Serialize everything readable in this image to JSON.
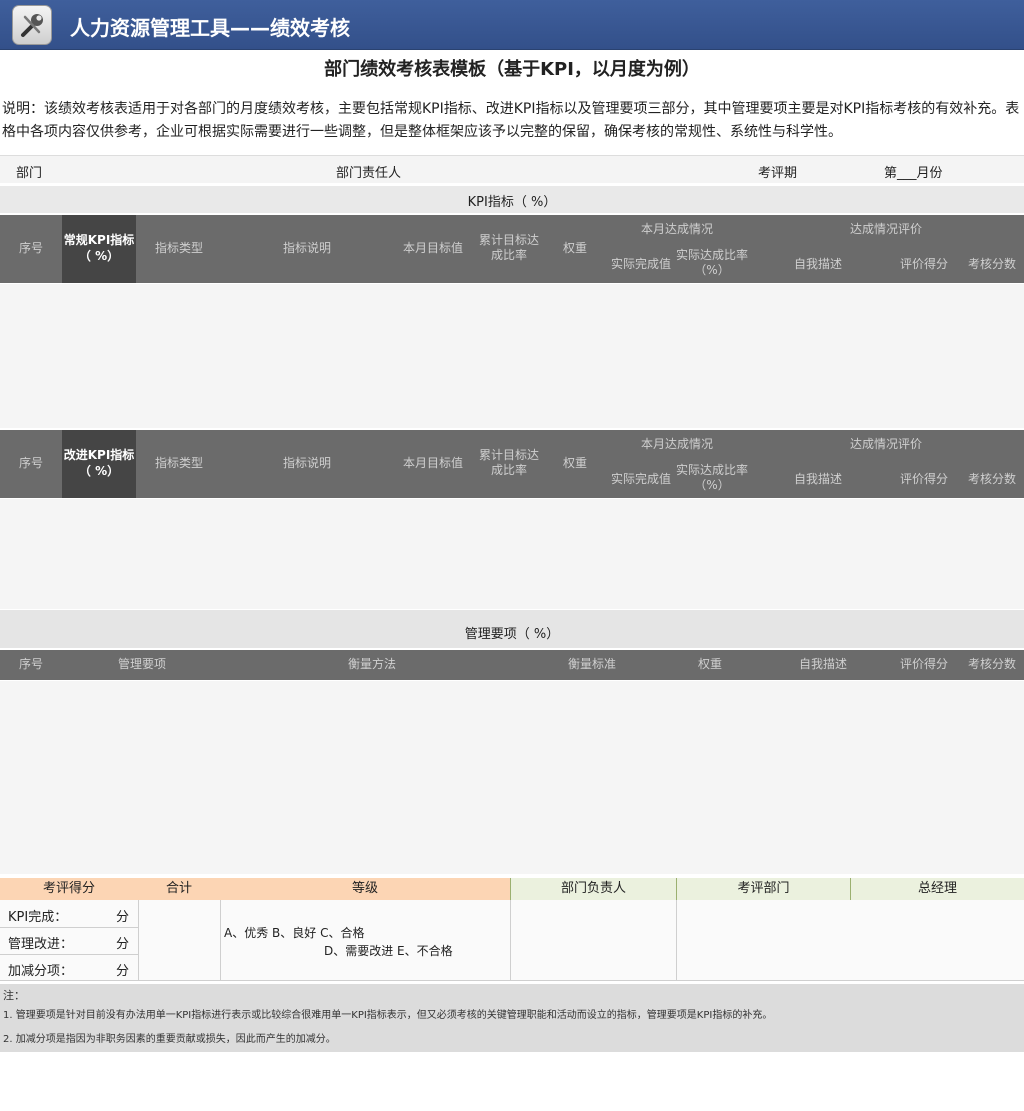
{
  "app": {
    "title": "人力资源管理工具——绩效考核",
    "icon": "tools-icon"
  },
  "document": {
    "title": "部门绩效考核表模板（基于KPI，以月度为例）",
    "description": "说明：该绩效考核表适用于对各部门的月度绩效考核，主要包括常规KPI指标、改进KPI指标以及管理要项三部分，其中管理要项主要是对KPI指标考核的有效补充。表格中各项内容仅供参考，企业可根据实际需要进行一些调整，但是整体框架应该予以完整的保留，确保考核的常规性、系统性与科学性。"
  },
  "info_row": {
    "dept_label": "部门",
    "manager_label": "部门责任人",
    "period_label": "考评期",
    "month_label": "第___月份"
  },
  "kpi_section": {
    "label": "KPI指标（      %）"
  },
  "table1": {
    "seq": "序号",
    "category": "常规KPI指标（  %）",
    "indicator_type": "指标类型",
    "indicator_def": "指标说明",
    "month_target": "本月目标值",
    "cumulative": "累计目标达成比率",
    "weight": "权重",
    "month_actual_group": "本月达成情况",
    "actual_value": "实际完成值",
    "actual_rate": "实际达成比率（%）",
    "eval_group": "达成情况评价",
    "self_desc": "自我描述",
    "review_score": "评价得分",
    "final_score": "考核分数"
  },
  "table2": {
    "seq": "序号",
    "category": "改进KPI指标（  %）",
    "indicator_type": "指标类型",
    "indicator_def": "指标说明",
    "month_target": "本月目标值",
    "cumulative": "累计目标达成比率",
    "weight": "权重",
    "month_actual_group": "本月达成情况",
    "actual_value": "实际完成值",
    "actual_rate": "实际达成比率（%）",
    "eval_group": "达成情况评价",
    "self_desc": "自我描述",
    "review_score": "评价得分",
    "final_score": "考核分数"
  },
  "mgmt_section": {
    "label": "管理要项（      %）"
  },
  "table3": {
    "seq": "序号",
    "item": "管理要项",
    "method": "衡量方法",
    "standard": "衡量标准",
    "weight": "权重",
    "self_desc": "自我描述",
    "review_score": "评价得分",
    "final_score": "考核分数"
  },
  "footer": {
    "score_head": "考评得分",
    "total_head": "合计",
    "grade_head": "等级",
    "manager_head": "部门负责人",
    "reviewer_head": "考评部门",
    "gm_head": "总经理",
    "kpi_done": "KPI完成：",
    "mgmt_improve": "管理改进：",
    "bonus": "加减分项：",
    "unit": "分",
    "grade_line1": "A、优秀  B、良好  C、合格",
    "grade_line2": "D、需要改进  E、不合格"
  },
  "notes": {
    "head": "注：",
    "note1": "1. 管理要项是针对目前没有办法用单一KPI指标进行表示或比较综合很难用单一KPI指标表示，但又必须考核的关键管理职能和活动而设立的指标，管理要项是KPI指标的补充。",
    "note2": "2. 加减分项是指因为非职务因素的重要贡献或损失，因此而产生的加减分。"
  }
}
